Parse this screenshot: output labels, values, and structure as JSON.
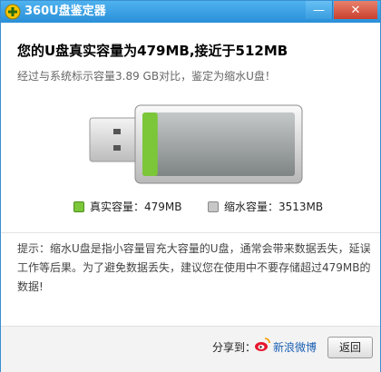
{
  "window": {
    "title": "360U盘鉴定器"
  },
  "controls": {
    "minimize_glyph": "—",
    "close_glyph": "✕"
  },
  "result": {
    "headline": "您的U盘真实容量为479MB,接近于512MB",
    "subline": "经过与系统标示容量3.89 GB对比，鉴定为缩水U盘！"
  },
  "drive": {
    "real_fraction": 0.1,
    "fill_color": "#7cc63a",
    "empty_color": "#a8adad"
  },
  "legend": {
    "real_label": "真实容量：479MB",
    "shrink_label": "缩水容量：3513MB",
    "real_color": "#7cc63a",
    "shrink_color": "#c7c7c7"
  },
  "tip": {
    "text": "提示：缩水U盘是指小容量冒充大容量的U盘，通常会带来数据丢失，延误工作等后果。为了避免数据丢失，建议您在使用中不要存储超过479MB的数据!"
  },
  "footer": {
    "share_label": "分享到：",
    "weibo_label": "新浪微博",
    "back_label": "返回"
  },
  "icons": {
    "app": "plus-circle-icon",
    "weibo": "weibo-icon"
  }
}
